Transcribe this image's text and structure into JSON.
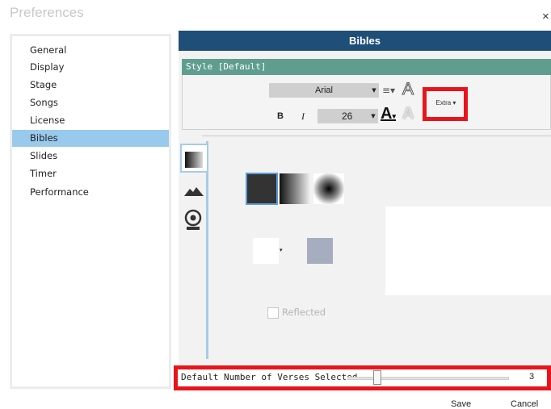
{
  "window": {
    "title": "Preferences",
    "close_glyph": "×"
  },
  "sidebar": {
    "items": [
      {
        "label": "General"
      },
      {
        "label": "Display"
      },
      {
        "label": "Stage"
      },
      {
        "label": "Songs"
      },
      {
        "label": "License"
      },
      {
        "label": "Bibles",
        "active": true
      },
      {
        "label": "Slides"
      },
      {
        "label": "Timer"
      },
      {
        "label": "Performance"
      }
    ]
  },
  "panel": {
    "title": "Bibles",
    "style_header": "Style [Default]",
    "font": {
      "family": "Arial",
      "size": "26"
    },
    "toolbar": {
      "bold": "B",
      "italic": "I",
      "extra_label": "Extra ▾"
    },
    "background": {
      "reflected_label": "Reflected"
    },
    "icons": {
      "align": "text-align-icon",
      "outline": "text-outline-icon",
      "color": "text-color-icon",
      "shadow": "text-shadow-icon",
      "tab_gradient": "gradient-icon",
      "tab_image": "image-icon",
      "tab_video": "video-icon"
    }
  },
  "verses": {
    "label": "Default Number of Verses Selected",
    "value": "3",
    "slider_fraction": 0.16
  },
  "buttons": {
    "save": "Save",
    "cancel": "Cancel"
  },
  "colors": {
    "header_bg": "#1f4e79",
    "style_header_bg": "#5f9e8f",
    "sidebar_active": "#99c9ec",
    "highlight": "#e8141c",
    "swatch_color": "#a5adbe"
  }
}
